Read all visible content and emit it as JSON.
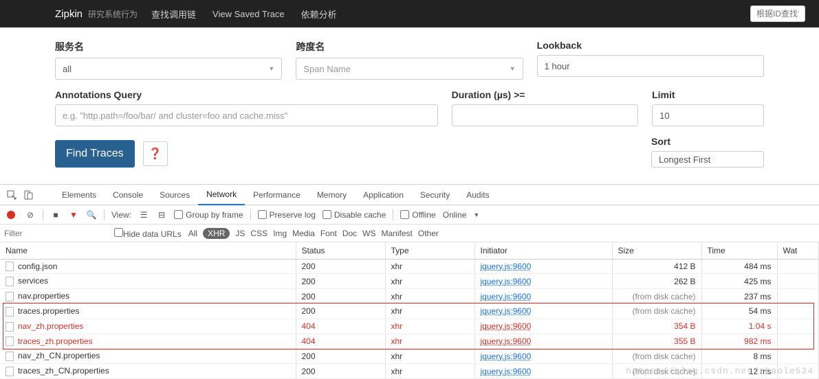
{
  "navbar": {
    "brand": "Zipkin",
    "subtitle": "研究系统行为",
    "links": [
      "查找调用链",
      "View Saved Trace",
      "依赖分析"
    ],
    "search_placeholder": "根据ID查找调用"
  },
  "form": {
    "service_label": "服务名",
    "service_value": "all",
    "span_label": "跨度名",
    "span_placeholder": "Span Name",
    "lookback_label": "Lookback",
    "lookback_value": "1 hour",
    "annotations_label": "Annotations Query",
    "annotations_placeholder": "e.g. \"http.path=/foo/bar/ and cluster=foo and cache.miss\"",
    "duration_label": "Duration (µs) >=",
    "duration_value": "",
    "limit_label": "Limit",
    "limit_value": "10",
    "sort_label": "Sort",
    "sort_value": "Longest First",
    "find_button": "Find Traces"
  },
  "devtools": {
    "tabs": [
      "Elements",
      "Console",
      "Sources",
      "Network",
      "Performance",
      "Memory",
      "Application",
      "Security",
      "Audits"
    ],
    "active_tab": "Network",
    "toolbar": {
      "view_label": "View:",
      "group_by_frame": "Group by frame",
      "preserve_log": "Preserve log",
      "disable_cache": "Disable cache",
      "offline": "Offline",
      "online": "Online"
    },
    "filter": {
      "placeholder": "Filter",
      "hide_data_urls": "Hide data URLs",
      "tags": [
        "All",
        "XHR",
        "JS",
        "CSS",
        "Img",
        "Media",
        "Font",
        "Doc",
        "WS",
        "Manifest",
        "Other"
      ],
      "active_tag": "XHR"
    },
    "columns": [
      "Name",
      "Status",
      "Type",
      "Initiator",
      "Size",
      "Time",
      "Wat"
    ],
    "rows": [
      {
        "name": "config.json",
        "status": "200",
        "type": "xhr",
        "initiator": "jquery.js:9600",
        "size": "412 B",
        "time": "484 ms",
        "err": false,
        "cache": false
      },
      {
        "name": "services",
        "status": "200",
        "type": "xhr",
        "initiator": "jquery.js:9600",
        "size": "262 B",
        "time": "425 ms",
        "err": false,
        "cache": false
      },
      {
        "name": "nav.properties",
        "status": "200",
        "type": "xhr",
        "initiator": "jquery.js:9600",
        "size": "(from disk cache)",
        "time": "237 ms",
        "err": false,
        "cache": true
      },
      {
        "name": "traces.properties",
        "status": "200",
        "type": "xhr",
        "initiator": "jquery.js:9600",
        "size": "(from disk cache)",
        "time": "54 ms",
        "err": false,
        "cache": true
      },
      {
        "name": "nav_zh.properties",
        "status": "404",
        "type": "xhr",
        "initiator": "jquery.js:9600",
        "size": "354 B",
        "time": "1.04 s",
        "err": true,
        "cache": false
      },
      {
        "name": "traces_zh.properties",
        "status": "404",
        "type": "xhr",
        "initiator": "jquery.js:9600",
        "size": "355 B",
        "time": "982 ms",
        "err": true,
        "cache": false
      },
      {
        "name": "nav_zh_CN.properties",
        "status": "200",
        "type": "xhr",
        "initiator": "jquery.js:9600",
        "size": "(from disk cache)",
        "time": "8 ms",
        "err": false,
        "cache": true
      },
      {
        "name": "traces_zh_CN.properties",
        "status": "200",
        "type": "xhr",
        "initiator": "jquery.js:9600",
        "size": "(from disk cache)",
        "time": "12 ms",
        "err": false,
        "cache": true
      }
    ]
  },
  "watermark": "https://blog.csdn.net/zhaole524"
}
